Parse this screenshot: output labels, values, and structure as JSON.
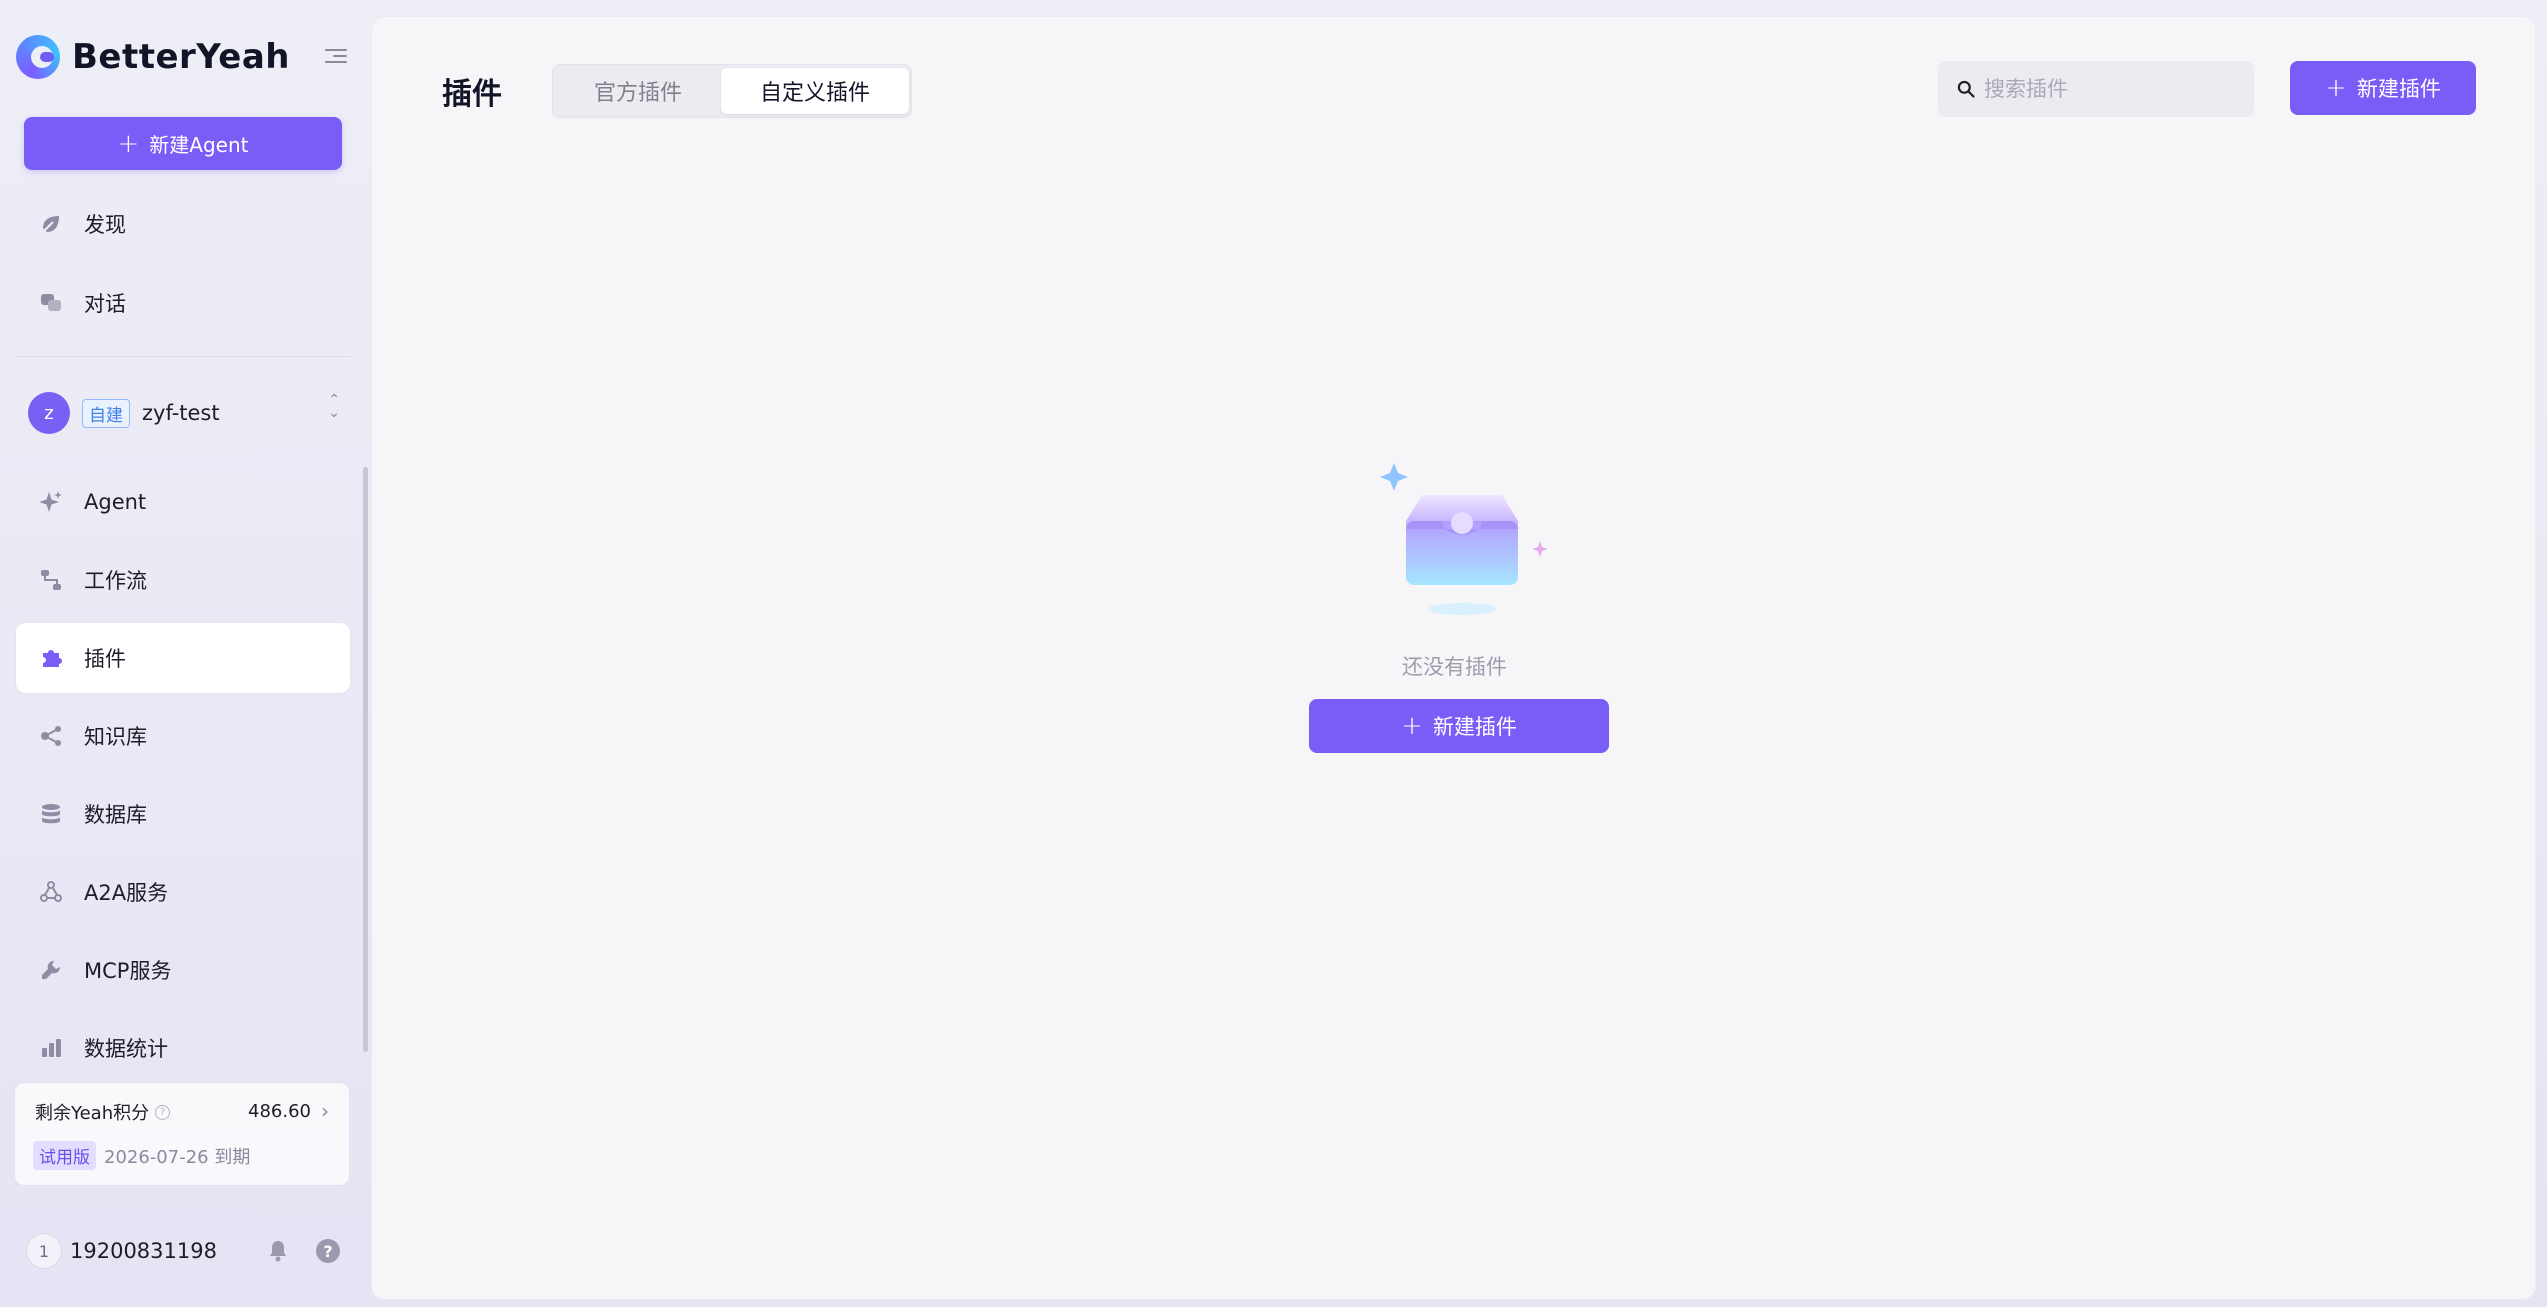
{
  "app": {
    "brand": "BetterYeah"
  },
  "sidebar": {
    "new_agent_label": "新建Agent",
    "top_items": [
      {
        "label": "发现",
        "icon": "compass-icon"
      },
      {
        "label": "对话",
        "icon": "chat-icon"
      }
    ],
    "workspace": {
      "avatar_letter": "z",
      "badge": "自建",
      "name": "zyf-test"
    },
    "items": [
      {
        "label": "Agent",
        "icon": "sparkle-icon"
      },
      {
        "label": "工作流",
        "icon": "workflow-icon"
      },
      {
        "label": "插件",
        "icon": "puzzle-icon",
        "active": true
      },
      {
        "label": "知识库",
        "icon": "knowledge-icon"
      },
      {
        "label": "数据库",
        "icon": "database-icon"
      },
      {
        "label": "A2A服务",
        "icon": "a2a-icon"
      },
      {
        "label": "MCP服务",
        "icon": "wrench-icon"
      },
      {
        "label": "数据统计",
        "icon": "bar-chart-icon"
      }
    ],
    "credits": {
      "title": "剩余Yeah积分",
      "value": "486.60",
      "plan_badge": "试用版",
      "expire_text": "2026-07-26 到期"
    },
    "user": {
      "avatar_letter": "1",
      "phone": "19200831198"
    }
  },
  "main": {
    "title": "插件",
    "tabs": [
      {
        "label": "官方插件",
        "active": false
      },
      {
        "label": "自定义插件",
        "active": true
      }
    ],
    "search_placeholder": "搜索插件",
    "new_button_label": "新建插件",
    "empty_text": "还没有插件",
    "empty_button_label": "新建插件"
  },
  "colors": {
    "accent": "#7a5cf7",
    "icon_gray": "#8e8da3"
  }
}
